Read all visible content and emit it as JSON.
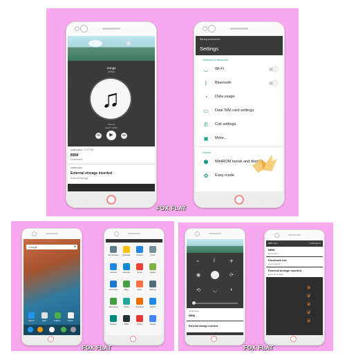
{
  "watermark": "FOX FLAT",
  "music_screen": {
    "song_title": "Songs",
    "song_artist": "Artists",
    "album_caption": "Albums",
    "time": "00:00 / 00:00",
    "notif1_header": "Notification · 3:47 PM",
    "notif1_title": "BBM",
    "notif1_sub": "Connected",
    "notif2_header": "Notification",
    "notif2_title": "External storage inserted",
    "notif2_sub": "External storage"
  },
  "settings_screen": {
    "status_text": "Saving screenshot...",
    "title": "Settings",
    "section_wireless": "Wireless & Networks",
    "items": [
      {
        "label": "Wi-Fi",
        "icon": "wifi-icon"
      },
      {
        "label": "Bluetooth",
        "icon": "bluetooth-icon"
      },
      {
        "label": "Data usage",
        "icon": "data-usage-icon"
      },
      {
        "label": "Dual SIM card settings",
        "icon": "sim-card-icon"
      },
      {
        "label": "Call settings",
        "icon": "phone-icon"
      },
      {
        "label": "More...",
        "icon": "more-icon"
      }
    ],
    "section_device": "Device",
    "device_items": [
      {
        "label": "MiniROM tweak and display",
        "icon": "tweak-icon"
      },
      {
        "label": "Easy mode",
        "icon": "easy-mode-icon"
      }
    ]
  },
  "home_screen": {
    "search_label": "Google",
    "dock_labels": [
      "Phone",
      "Web",
      "Gallery",
      "Music"
    ]
  },
  "app_drawer": {
    "apps": [
      "File Manager",
      "Calculator",
      "Camera",
      "Clock",
      "Contacts",
      "Calendar",
      "Email",
      "Gallery",
      "Downloads",
      "Maps",
      "Music",
      "Settings",
      "Messaging",
      "Phone",
      "Play Store",
      "Search",
      "Browser",
      "BBM",
      "Photos",
      "Google"
    ]
  },
  "quick_settings": {
    "notif_header": "Notification",
    "notif_title": "BBM",
    "notif2_title": "External storage inserted"
  },
  "notif_shade": {
    "header_left": "BBM Tech",
    "header_right": "Notifications",
    "items": [
      {
        "title": "BBM",
        "sub": "Connected"
      },
      {
        "title": "Facebook Lite",
        "sub": "Downloading"
      },
      {
        "title": "External storage inserted",
        "sub": "External storage"
      }
    ]
  },
  "colors": {
    "background_pink": "#f7a8ee",
    "accent_teal": "#1a9a8a",
    "home_button_ring": "#f08a8a"
  }
}
